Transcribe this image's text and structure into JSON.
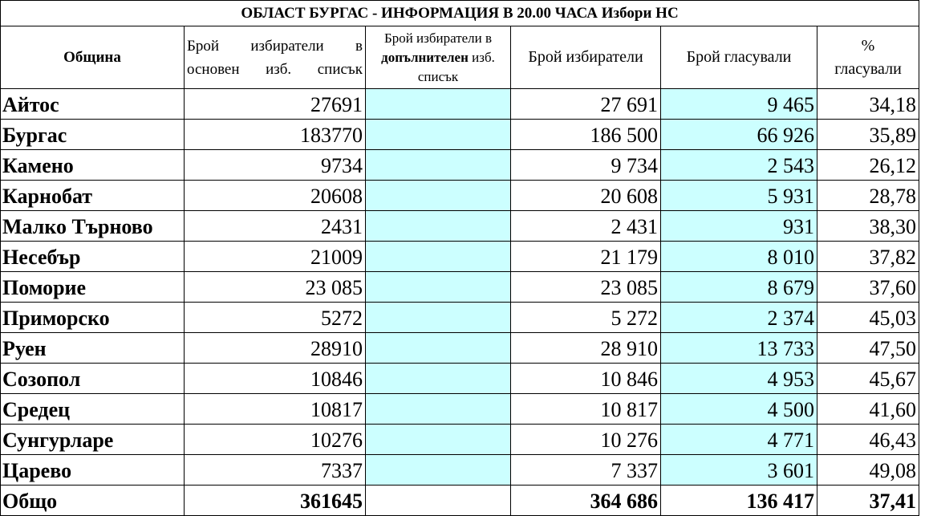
{
  "title": "ОБЛАСТ БУРГАС -  ИНФОРМАЦИЯ В 20.00 ЧАСА Избори НС",
  "headers": {
    "municipality": "Община",
    "main_list": "Брой избиратели в основен изб. списък",
    "additional_list_pre": "Брой избиратели в",
    "additional_list_bold": "допълнителен",
    "additional_list_post": "изб. списък",
    "voters": "Брой избиратели",
    "voted": "Брой гласували",
    "percent_sign": "%",
    "percent_label": "гласували"
  },
  "rows": [
    {
      "name": "Айтос",
      "main": "27691",
      "additional": "",
      "voters": "27 691",
      "voted": "9 465",
      "percent": "34,18"
    },
    {
      "name": "Бургас",
      "main": "183770",
      "additional": "",
      "voters": "186 500",
      "voted": "66 926",
      "percent": "35,89"
    },
    {
      "name": "Камено",
      "main": "9734",
      "additional": "",
      "voters": "9 734",
      "voted": "2 543",
      "percent": "26,12"
    },
    {
      "name": "Карнобат",
      "main": "20608",
      "additional": "",
      "voters": "20 608",
      "voted": "5 931",
      "percent": "28,78"
    },
    {
      "name": "Малко Търново",
      "main": "2431",
      "additional": "",
      "voters": "2 431",
      "voted": "931",
      "percent": "38,30"
    },
    {
      "name": "Несебър",
      "main": "21009",
      "additional": "",
      "voters": "21 179",
      "voted": "8 010",
      "percent": "37,82"
    },
    {
      "name": "Поморие",
      "main": "23 085",
      "additional": "",
      "voters": "23 085",
      "voted": "8 679",
      "percent": "37,60"
    },
    {
      "name": "Приморско",
      "main": "5272",
      "additional": "",
      "voters": "5 272",
      "voted": "2 374",
      "percent": "45,03"
    },
    {
      "name": "Руен",
      "main": "28910",
      "additional": "",
      "voters": "28 910",
      "voted": "13 733",
      "percent": "47,50"
    },
    {
      "name": "Созопол",
      "main": "10846",
      "additional": "",
      "voters": "10 846",
      "voted": "4 953",
      "percent": "45,67"
    },
    {
      "name": "Средец",
      "main": "10817",
      "additional": "",
      "voters": "10 817",
      "voted": "4 500",
      "percent": "41,60"
    },
    {
      "name": "Сунгурларе",
      "main": "10276",
      "additional": "",
      "voters": "10 276",
      "voted": "4 771",
      "percent": "46,43"
    },
    {
      "name": "Царево",
      "main": "7337",
      "additional": "",
      "voters": "7 337",
      "voted": "3 601",
      "percent": "49,08"
    }
  ],
  "total": {
    "name": "Общо",
    "main": "361645",
    "additional": "",
    "voters": "364 686",
    "voted": "136 417",
    "percent": "37,41"
  },
  "colors": {
    "highlight": "#ccffff",
    "border": "#000000"
  }
}
